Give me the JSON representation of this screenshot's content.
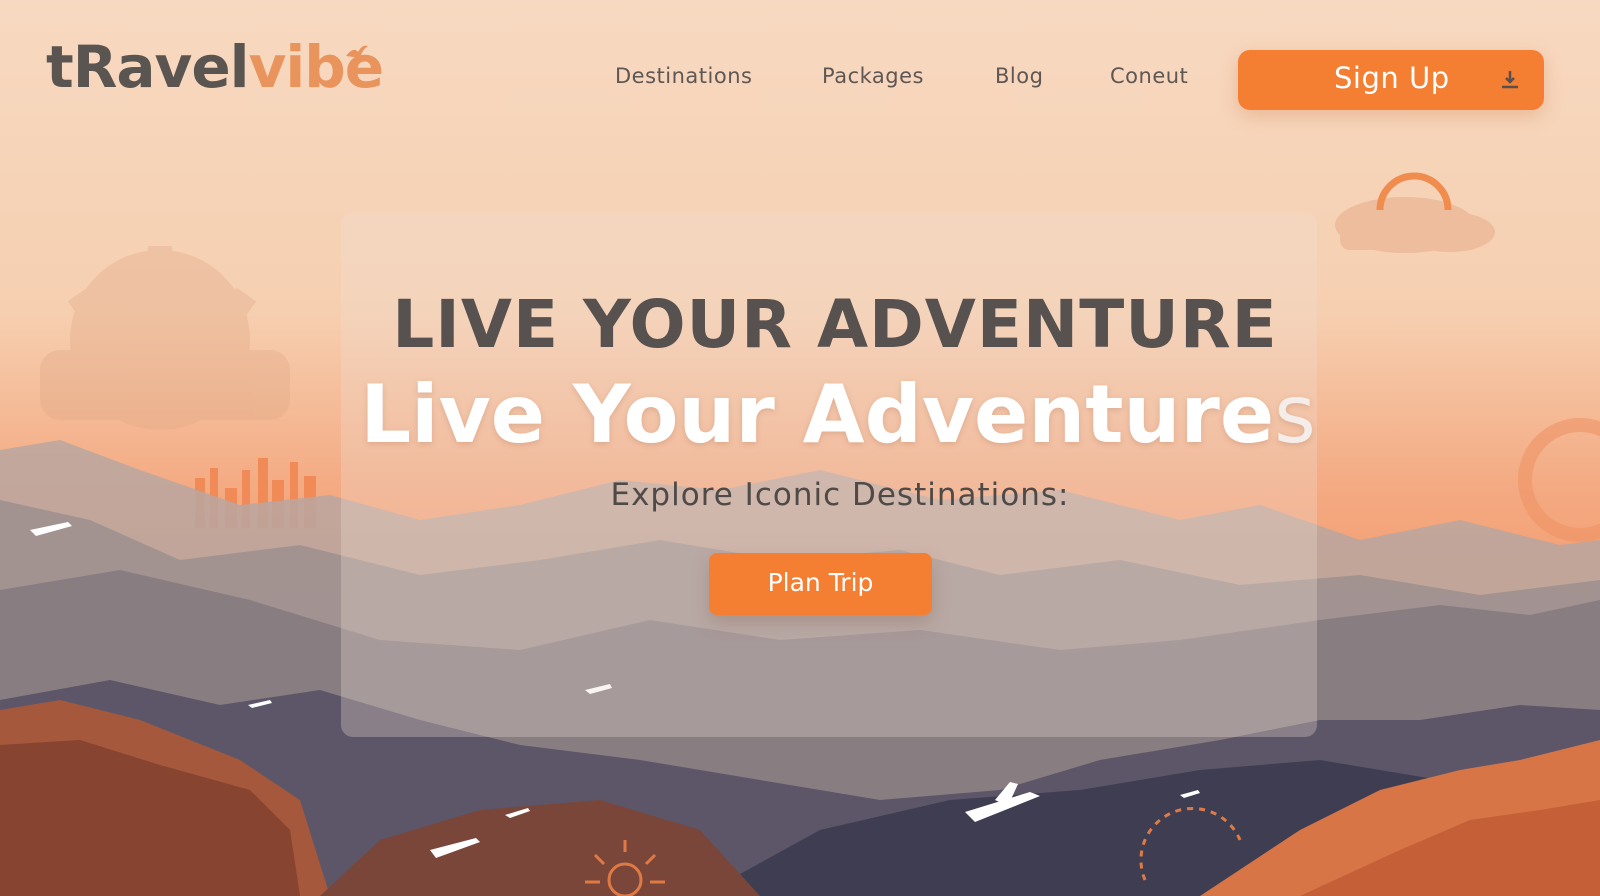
{
  "brand": {
    "logo_part1": "tRavel",
    "logo_part2": "vibe"
  },
  "nav": {
    "links": [
      {
        "label": "Destinations"
      },
      {
        "label": "Packages"
      },
      {
        "label": "Blog"
      },
      {
        "label": "Coneut"
      }
    ],
    "signup_label": "Sign Up",
    "signup_icon": "upload-icon"
  },
  "hero": {
    "headline": "LIVE YOUR ADVENTURE",
    "subheadline_main": "Live Your Adventure",
    "subheadline_tail": "s",
    "tagline": "Explore Iconic Destinations:",
    "cta_label": "Plan Trip"
  },
  "colors": {
    "accent": "#f47e32",
    "sky_top": "#f6d6bc",
    "text_dark": "#57514f",
    "logo_accent": "#e8945c"
  }
}
